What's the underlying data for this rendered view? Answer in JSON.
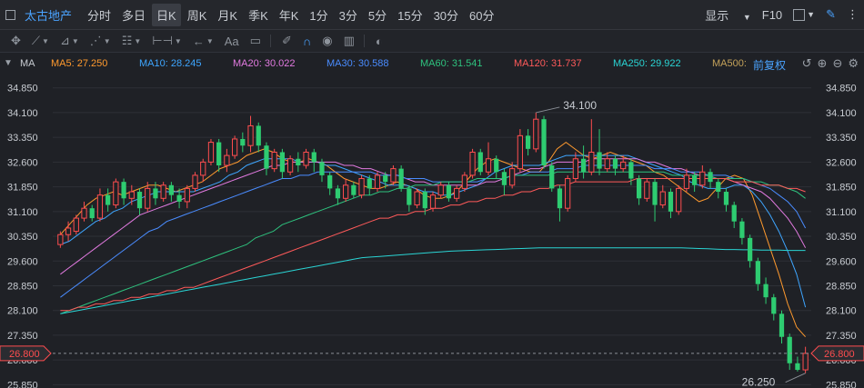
{
  "toolbar": {
    "name": "太古地产",
    "periods": [
      "分时",
      "多日",
      "日K",
      "周K",
      "月K",
      "季K",
      "年K",
      "1分",
      "3分",
      "5分",
      "15分",
      "30分",
      "60分"
    ],
    "active_period": "日K",
    "display_label": "显示",
    "f10_label": "F10"
  },
  "drawbar": {
    "font_label": "Aa"
  },
  "ma": {
    "label": "MA",
    "adjust_label": "前复权",
    "items": [
      {
        "text": "MA5: 27.250",
        "color": "#ff9a2e"
      },
      {
        "text": "MA10: 28.245",
        "color": "#3ea6ff"
      },
      {
        "text": "MA20: 30.022",
        "color": "#e27ae0"
      },
      {
        "text": "MA30: 30.588",
        "color": "#4a8cff"
      },
      {
        "text": "MA60: 31.541",
        "color": "#2ec27e"
      },
      {
        "text": "MA120: 31.737",
        "color": "#ff5a5a"
      },
      {
        "text": "MA250: 29.922",
        "color": "#2ad4d4"
      },
      {
        "text": "MA500:",
        "color": "#c4a25a"
      }
    ]
  },
  "chart_data": {
    "type": "candlestick",
    "y_ticks": [
      "34.850",
      "34.100",
      "33.350",
      "32.600",
      "31.850",
      "31.100",
      "30.350",
      "29.600",
      "28.850",
      "28.100",
      "27.350",
      "26.600",
      "25.850"
    ],
    "ylim": [
      25.75,
      35.2
    ],
    "current_price": "26.800",
    "annotations": {
      "high": "34.100",
      "low": "26.250"
    },
    "up_color": "#ff4d4f",
    "down_color": "#2ecc71",
    "ma_colors": {
      "ma5": "#ff9a2e",
      "ma10": "#3ea6ff",
      "ma20": "#e27ae0",
      "ma30": "#4a8cff",
      "ma60": "#2ec27e",
      "ma120": "#ff5a5a",
      "ma250": "#2ad4d4"
    },
    "ma_lines": {
      "ma5": [
        30.4,
        30.7,
        31.0,
        31.3,
        31.5,
        31.6,
        31.7,
        31.6,
        31.7,
        31.8,
        31.9,
        31.9,
        31.8,
        31.7,
        31.8,
        31.9,
        32.0,
        32.2,
        32.4,
        32.5,
        32.6,
        32.8,
        32.9,
        33.0,
        32.9,
        32.7,
        32.6,
        32.6,
        32.7,
        32.6,
        32.5,
        32.3,
        32.1,
        32.0,
        31.9,
        31.8,
        31.8,
        31.9,
        32.0,
        31.9,
        31.8,
        31.6,
        31.5,
        31.5,
        31.6,
        31.8,
        32.1,
        32.4,
        32.6,
        32.7,
        32.6,
        32.5,
        32.4,
        32.3,
        32.3,
        32.6,
        33.0,
        33.2,
        33.0,
        32.8,
        32.7,
        32.8,
        32.9,
        32.8,
        32.7,
        32.6,
        32.5,
        32.3,
        32.2,
        32.0,
        31.8,
        31.6,
        31.4,
        31.5,
        31.8,
        32.1,
        32.2,
        32.1,
        31.6,
        30.8,
        30.0,
        29.2,
        28.3,
        27.6,
        27.3
      ],
      "ma10": [
        30.1,
        30.2,
        30.4,
        30.6,
        30.8,
        30.9,
        31.1,
        31.2,
        31.4,
        31.5,
        31.6,
        31.7,
        31.7,
        31.7,
        31.7,
        31.7,
        31.8,
        31.9,
        32.0,
        32.2,
        32.3,
        32.5,
        32.6,
        32.7,
        32.7,
        32.7,
        32.7,
        32.6,
        32.6,
        32.6,
        32.5,
        32.5,
        32.4,
        32.3,
        32.2,
        32.1,
        32.0,
        31.9,
        31.9,
        31.9,
        31.8,
        31.7,
        31.7,
        31.6,
        31.6,
        31.7,
        31.8,
        31.9,
        32.1,
        32.3,
        32.4,
        32.5,
        32.5,
        32.5,
        32.5,
        32.6,
        32.7,
        32.8,
        32.8,
        32.8,
        32.8,
        32.8,
        32.8,
        32.8,
        32.8,
        32.7,
        32.6,
        32.5,
        32.4,
        32.3,
        32.2,
        32.0,
        31.9,
        31.8,
        31.8,
        31.8,
        31.9,
        31.9,
        31.7,
        31.4,
        31.0,
        30.5,
        29.9,
        29.2,
        28.2
      ],
      "ma20": [
        29.2,
        29.4,
        29.6,
        29.8,
        30.0,
        30.2,
        30.4,
        30.6,
        30.8,
        31.0,
        31.1,
        31.2,
        31.3,
        31.4,
        31.5,
        31.6,
        31.7,
        31.8,
        31.9,
        32.0,
        32.1,
        32.2,
        32.3,
        32.4,
        32.5,
        32.5,
        32.6,
        32.6,
        32.6,
        32.6,
        32.6,
        32.6,
        32.5,
        32.5,
        32.4,
        32.4,
        32.3,
        32.2,
        32.2,
        32.1,
        32.0,
        32.0,
        31.9,
        31.9,
        31.9,
        31.9,
        31.9,
        31.9,
        32.0,
        32.0,
        32.1,
        32.2,
        32.3,
        32.4,
        32.4,
        32.5,
        32.6,
        32.6,
        32.6,
        32.6,
        32.7,
        32.7,
        32.7,
        32.7,
        32.7,
        32.7,
        32.6,
        32.6,
        32.5,
        32.4,
        32.4,
        32.3,
        32.2,
        32.2,
        32.1,
        32.1,
        32.0,
        31.9,
        31.8,
        31.7,
        31.5,
        31.2,
        30.9,
        30.5,
        30.0
      ],
      "ma30": [
        28.5,
        28.7,
        28.9,
        29.1,
        29.3,
        29.5,
        29.7,
        29.9,
        30.1,
        30.3,
        30.5,
        30.6,
        30.8,
        30.9,
        31.0,
        31.1,
        31.2,
        31.3,
        31.4,
        31.5,
        31.6,
        31.7,
        31.8,
        31.9,
        32.0,
        32.1,
        32.1,
        32.2,
        32.2,
        32.3,
        32.3,
        32.3,
        32.3,
        32.3,
        32.3,
        32.3,
        32.2,
        32.2,
        32.2,
        32.1,
        32.1,
        32.1,
        32.0,
        32.0,
        32.0,
        32.0,
        32.0,
        32.0,
        32.1,
        32.1,
        32.1,
        32.2,
        32.2,
        32.3,
        32.3,
        32.3,
        32.4,
        32.4,
        32.4,
        32.5,
        32.5,
        32.5,
        32.5,
        32.5,
        32.5,
        32.5,
        32.5,
        32.4,
        32.4,
        32.4,
        32.3,
        32.3,
        32.3,
        32.2,
        32.2,
        32.2,
        32.1,
        32.1,
        32.0,
        31.9,
        31.8,
        31.6,
        31.4,
        31.1,
        30.6
      ],
      "ma60": [
        28.0,
        28.1,
        28.2,
        28.3,
        28.4,
        28.5,
        28.6,
        28.7,
        28.8,
        28.9,
        29.0,
        29.1,
        29.2,
        29.3,
        29.4,
        29.5,
        29.6,
        29.7,
        29.8,
        29.9,
        30.0,
        30.1,
        30.3,
        30.4,
        30.5,
        30.7,
        30.8,
        30.9,
        31.0,
        31.1,
        31.2,
        31.3,
        31.4,
        31.5,
        31.6,
        31.6,
        31.7,
        31.7,
        31.8,
        31.8,
        31.9,
        31.9,
        31.9,
        32.0,
        32.0,
        32.0,
        32.0,
        32.1,
        32.1,
        32.1,
        32.1,
        32.2,
        32.2,
        32.2,
        32.2,
        32.2,
        32.3,
        32.3,
        32.3,
        32.3,
        32.3,
        32.3,
        32.3,
        32.3,
        32.3,
        32.3,
        32.3,
        32.3,
        32.3,
        32.2,
        32.2,
        32.2,
        32.2,
        32.2,
        32.1,
        32.1,
        32.1,
        32.1,
        32.0,
        32.0,
        31.9,
        31.9,
        31.8,
        31.7,
        31.5
      ],
      "ma120": [
        28.1,
        28.1,
        28.2,
        28.2,
        28.3,
        28.3,
        28.4,
        28.4,
        28.5,
        28.5,
        28.6,
        28.6,
        28.7,
        28.7,
        28.8,
        28.8,
        28.9,
        29.0,
        29.1,
        29.2,
        29.3,
        29.4,
        29.5,
        29.6,
        29.7,
        29.8,
        29.9,
        30.0,
        30.1,
        30.2,
        30.3,
        30.4,
        30.5,
        30.6,
        30.7,
        30.8,
        30.9,
        30.9,
        31.0,
        31.0,
        31.1,
        31.1,
        31.2,
        31.2,
        31.3,
        31.3,
        31.4,
        31.4,
        31.5,
        31.5,
        31.6,
        31.6,
        31.7,
        31.7,
        31.8,
        31.8,
        31.9,
        31.9,
        32.0,
        32.0,
        32.0,
        32.0,
        32.0,
        32.0,
        32.0,
        32.1,
        32.1,
        32.1,
        32.1,
        32.1,
        32.1,
        32.1,
        32.1,
        32.1,
        32.1,
        32.1,
        32.0,
        32.0,
        32.0,
        31.9,
        31.9,
        31.9,
        31.8,
        31.8,
        31.7
      ],
      "ma250": [
        28.0,
        28.05,
        28.1,
        28.15,
        28.2,
        28.25,
        28.3,
        28.35,
        28.4,
        28.45,
        28.5,
        28.55,
        28.6,
        28.65,
        28.7,
        28.75,
        28.8,
        28.85,
        28.9,
        28.95,
        29.0,
        29.05,
        29.1,
        29.15,
        29.2,
        29.25,
        29.3,
        29.35,
        29.4,
        29.45,
        29.5,
        29.55,
        29.6,
        29.65,
        29.7,
        29.72,
        29.74,
        29.76,
        29.78,
        29.8,
        29.82,
        29.84,
        29.86,
        29.88,
        29.9,
        29.91,
        29.92,
        29.93,
        29.94,
        29.95,
        29.96,
        29.97,
        29.98,
        29.99,
        30.0,
        30.0,
        30.0,
        30.0,
        30.0,
        30.0,
        30.0,
        30.0,
        30.0,
        30.0,
        30.0,
        30.0,
        30.0,
        30.0,
        30.0,
        30.0,
        30.0,
        29.99,
        29.98,
        29.97,
        29.96,
        29.95,
        29.95,
        29.94,
        29.94,
        29.93,
        29.93,
        29.93,
        29.92,
        29.92,
        29.92
      ]
    },
    "candles": [
      [
        30.1,
        30.4,
        30.0,
        30.5
      ],
      [
        30.4,
        30.6,
        30.2,
        30.8
      ],
      [
        30.5,
        30.9,
        30.4,
        31.0
      ],
      [
        30.9,
        31.2,
        30.8,
        31.4
      ],
      [
        31.2,
        30.9,
        30.8,
        31.3
      ],
      [
        30.9,
        31.6,
        30.8,
        31.8
      ],
      [
        31.6,
        31.3,
        31.1,
        31.8
      ],
      [
        31.3,
        32.0,
        31.2,
        32.1
      ],
      [
        32.0,
        31.5,
        31.3,
        32.1
      ],
      [
        31.5,
        31.7,
        31.3,
        31.9
      ],
      [
        31.7,
        31.2,
        31.0,
        31.8
      ],
      [
        31.2,
        31.8,
        31.1,
        32.0
      ],
      [
        31.8,
        31.5,
        31.3,
        32.0
      ],
      [
        31.5,
        31.9,
        31.4,
        32.0
      ],
      [
        31.9,
        31.6,
        31.4,
        32.0
      ],
      [
        31.6,
        31.4,
        31.2,
        31.8
      ],
      [
        31.4,
        31.8,
        31.2,
        31.9
      ],
      [
        31.8,
        32.2,
        31.7,
        32.3
      ],
      [
        32.2,
        32.6,
        32.0,
        32.7
      ],
      [
        32.6,
        33.2,
        32.5,
        33.3
      ],
      [
        33.2,
        32.5,
        32.3,
        33.3
      ],
      [
        32.5,
        32.8,
        32.3,
        33.0
      ],
      [
        32.8,
        33.3,
        32.7,
        33.4
      ],
      [
        33.3,
        33.1,
        32.9,
        33.5
      ],
      [
        33.1,
        33.7,
        32.9,
        34.0
      ],
      [
        33.7,
        33.1,
        32.9,
        33.8
      ],
      [
        33.1,
        32.4,
        32.2,
        33.2
      ],
      [
        32.4,
        32.9,
        32.3,
        33.0
      ],
      [
        32.9,
        32.3,
        32.1,
        33.0
      ],
      [
        32.3,
        32.7,
        32.2,
        32.8
      ],
      [
        32.7,
        32.5,
        32.3,
        32.9
      ],
      [
        32.5,
        32.9,
        32.4,
        33.0
      ],
      [
        32.9,
        32.6,
        32.3,
        33.0
      ],
      [
        32.6,
        32.2,
        32.0,
        32.7
      ],
      [
        32.2,
        31.8,
        31.6,
        32.3
      ],
      [
        31.8,
        31.5,
        31.3,
        31.9
      ],
      [
        31.5,
        31.9,
        31.4,
        32.1
      ],
      [
        31.9,
        31.6,
        31.5,
        32.0
      ],
      [
        31.6,
        32.1,
        31.5,
        32.2
      ],
      [
        32.1,
        31.8,
        31.6,
        32.2
      ],
      [
        31.8,
        32.2,
        31.7,
        32.3
      ],
      [
        32.2,
        32.0,
        31.8,
        32.3
      ],
      [
        32.0,
        32.4,
        31.9,
        32.5
      ],
      [
        32.4,
        31.8,
        31.7,
        32.5
      ],
      [
        31.8,
        31.3,
        31.1,
        31.9
      ],
      [
        31.3,
        31.7,
        31.2,
        31.8
      ],
      [
        31.7,
        31.2,
        31.0,
        31.8
      ],
      [
        31.2,
        31.6,
        31.1,
        31.7
      ],
      [
        31.6,
        31.9,
        31.5,
        32.0
      ],
      [
        31.9,
        31.5,
        31.4,
        32.0
      ],
      [
        31.5,
        31.8,
        31.4,
        31.9
      ],
      [
        31.8,
        32.2,
        31.7,
        32.3
      ],
      [
        32.2,
        32.9,
        32.1,
        33.0
      ],
      [
        32.9,
        32.3,
        32.2,
        33.0
      ],
      [
        32.3,
        32.7,
        32.2,
        33.2
      ],
      [
        32.7,
        32.3,
        32.1,
        32.8
      ],
      [
        32.3,
        31.9,
        31.6,
        32.4
      ],
      [
        31.9,
        32.4,
        31.8,
        32.6
      ],
      [
        32.4,
        33.4,
        32.3,
        33.6
      ],
      [
        33.4,
        33.0,
        32.8,
        33.6
      ],
      [
        33.0,
        33.9,
        32.9,
        34.1
      ],
      [
        33.9,
        32.5,
        32.4,
        34.0
      ],
      [
        32.5,
        31.8,
        31.7,
        32.6
      ],
      [
        31.8,
        31.2,
        30.8,
        31.9
      ],
      [
        31.2,
        32.1,
        31.1,
        32.2
      ],
      [
        32.1,
        32.7,
        32.0,
        32.9
      ],
      [
        32.7,
        32.3,
        32.1,
        33.1
      ],
      [
        32.3,
        32.9,
        32.2,
        33.9
      ],
      [
        32.9,
        32.4,
        32.2,
        33.6
      ],
      [
        32.4,
        32.7,
        32.3,
        32.9
      ],
      [
        32.7,
        32.4,
        32.2,
        32.8
      ],
      [
        32.4,
        32.6,
        32.3,
        32.8
      ],
      [
        32.6,
        32.1,
        31.9,
        32.7
      ],
      [
        32.1,
        31.5,
        31.3,
        32.2
      ],
      [
        31.5,
        32.0,
        31.4,
        32.1
      ],
      [
        32.0,
        31.3,
        30.8,
        32.1
      ],
      [
        31.3,
        31.7,
        31.2,
        31.9
      ],
      [
        31.7,
        31.1,
        30.9,
        31.8
      ],
      [
        31.1,
        31.8,
        31.0,
        31.9
      ],
      [
        31.8,
        32.2,
        31.7,
        32.4
      ],
      [
        32.2,
        31.9,
        31.7,
        32.3
      ],
      [
        31.9,
        32.3,
        31.8,
        32.5
      ],
      [
        32.3,
        32.0,
        31.8,
        32.4
      ],
      [
        32.0,
        31.7,
        31.5,
        32.1
      ],
      [
        31.7,
        31.3,
        31.1,
        31.8
      ],
      [
        31.3,
        30.8,
        30.6,
        31.4
      ],
      [
        30.8,
        30.3,
        30.1,
        30.9
      ],
      [
        30.3,
        29.6,
        29.4,
        30.4
      ],
      [
        29.6,
        28.9,
        28.7,
        29.7
      ],
      [
        28.9,
        28.5,
        28.3,
        29.1
      ],
      [
        28.5,
        28.0,
        27.8,
        28.6
      ],
      [
        28.0,
        27.3,
        27.1,
        28.1
      ],
      [
        27.3,
        26.5,
        26.3,
        27.4
      ],
      [
        26.5,
        26.3,
        26.25,
        26.7
      ],
      [
        26.3,
        26.8,
        26.2,
        27.0
      ]
    ]
  }
}
